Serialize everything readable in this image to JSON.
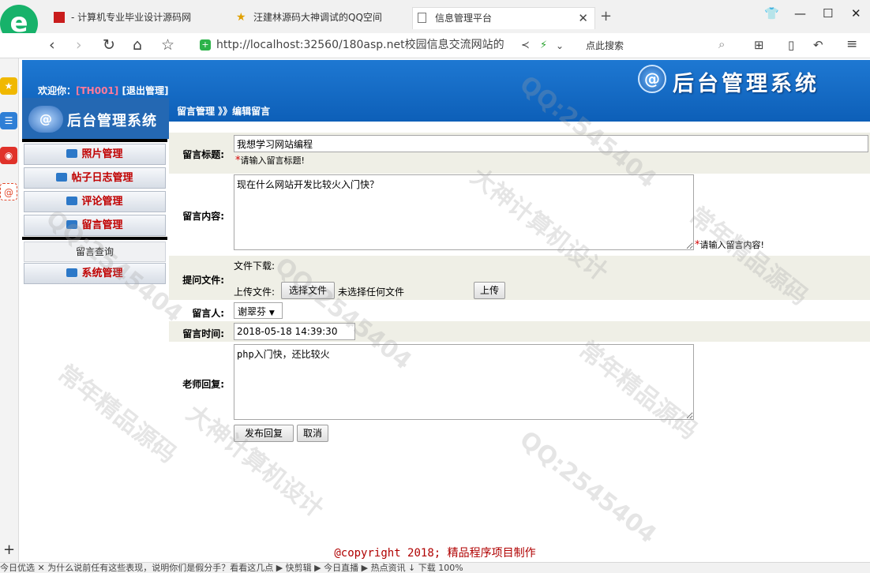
{
  "browser": {
    "logo_glyph": "e",
    "tabs": [
      {
        "label": "- 计算机专业毕业设计源码网"
      },
      {
        "label": "汪建林源码大神调试的QQ空间"
      },
      {
        "label": "信息管理平台"
      }
    ],
    "close_glyph": "✕",
    "newtab_glyph": "+",
    "url": "http://localhost:32560/180asp.net校园信息交流网站的",
    "search_placeholder": "点此搜索",
    "status_items": "今日优选   ✕ 为什么说前任有这些表现，说明你们是假分手？看看这几点       ▶ 快剪辑   ▶ 今日直播   ▶ 热点资讯        ↓ 下载             100%"
  },
  "page": {
    "welcome_prefix": "欢迎你：",
    "username": "[TH001]",
    "logout": "[退出管理]",
    "brand_title": "后台管理系统",
    "side_brand": "后台管理系统",
    "breadcrumb": "留言管理 》》编辑留言",
    "footer": "@copyright 2018; 精品程序项目制作"
  },
  "sidebar": {
    "items": [
      {
        "label": "照片管理"
      },
      {
        "label": "帖子日志管理"
      },
      {
        "label": "评论管理"
      },
      {
        "label": "留言管理"
      },
      {
        "label": "留言查询"
      },
      {
        "label": "系统管理"
      }
    ]
  },
  "form": {
    "title_label": "留言标题:",
    "title_value": "我想学习网站编程",
    "title_hint": "请输入留言标题!",
    "content_label": "留言内容:",
    "content_value": "现在什么网站开发比较火入门快？",
    "content_hint": "请输入留言内容!",
    "file_label": "提问文件:",
    "file_download": "文件下载:",
    "file_upload_label": "上传文件:",
    "choose_file": "选择文件",
    "no_file": "未选择任何文件",
    "upload_button": "上传",
    "author_label": "留言人:",
    "author_value": "谢翠芬",
    "time_label": "留言时间:",
    "time_value": "2018-05-18 14:39:30",
    "reply_label": "老师回复:",
    "reply_value": "php入门快，还比较火",
    "submit": "发布回复",
    "cancel": "取消"
  },
  "watermarks": [
    "QQ:2545404",
    "大神计算机设计",
    "常年精品源码"
  ]
}
